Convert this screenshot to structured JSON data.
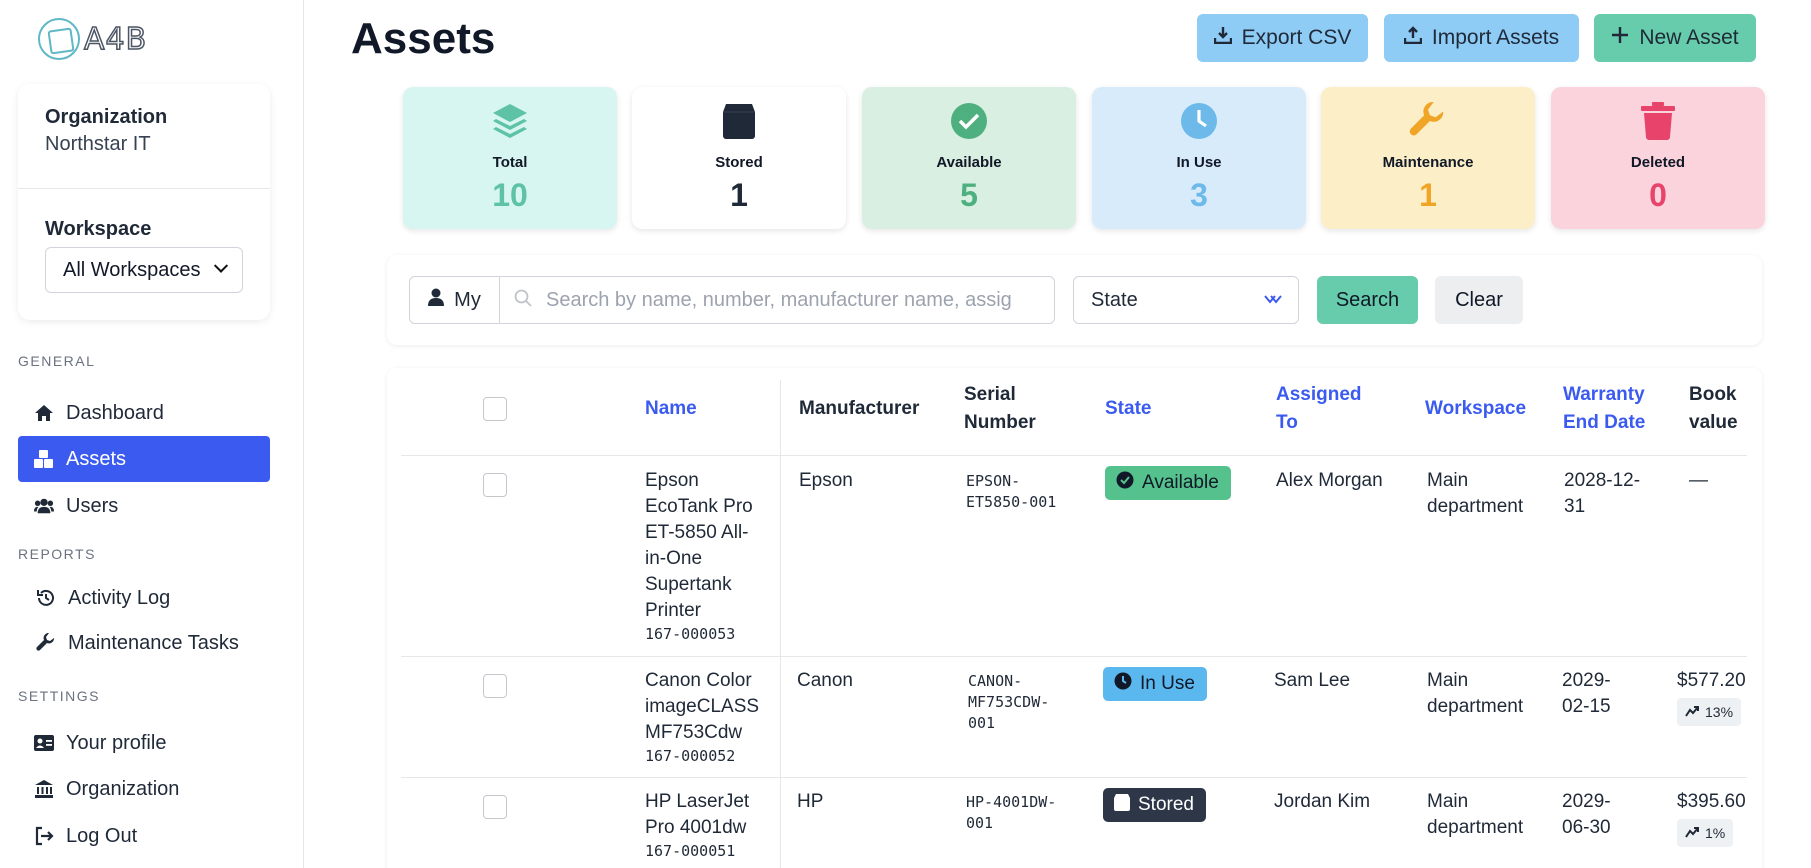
{
  "brand": {
    "logo_text": "A4B"
  },
  "org": {
    "label": "Organization",
    "name": "Northstar IT",
    "workspace_label": "Workspace",
    "workspace_value": "All Workspaces"
  },
  "nav": {
    "general_header": "GENERAL",
    "dashboard": "Dashboard",
    "assets": "Assets",
    "users": "Users",
    "reports_header": "REPORTS",
    "activity_log": "Activity Log",
    "maintenance_tasks": "Maintenance Tasks",
    "settings_header": "SETTINGS",
    "profile": "Your profile",
    "organization": "Organization",
    "logout": "Log Out"
  },
  "header": {
    "title": "Assets",
    "export": "Export CSV",
    "import": "Import Assets",
    "new": "New Asset"
  },
  "stats": [
    {
      "label": "Total",
      "value": "10",
      "color": "#5ec2a7",
      "bg": "#d7f6f1"
    },
    {
      "label": "Stored",
      "value": "1",
      "color": "#1f2937",
      "bg": "#ffffff"
    },
    {
      "label": "Available",
      "value": "5",
      "color": "#4fb07f",
      "bg": "#d9efe2"
    },
    {
      "label": "In Use",
      "value": "3",
      "color": "#6cb9ea",
      "bg": "#d8ebfb"
    },
    {
      "label": "Maintenance",
      "value": "1",
      "color": "#f0a526",
      "bg": "#fcefc7"
    },
    {
      "label": "Deleted",
      "value": "0",
      "color": "#e7436b",
      "bg": "#fbd3dd"
    }
  ],
  "filters": {
    "my": "My",
    "search_placeholder": "Search by name, number, manufacturer name, assig",
    "state": "State",
    "search_btn": "Search",
    "clear_btn": "Clear"
  },
  "table": {
    "headers": {
      "name": "Name",
      "manufacturer": "Manufacturer",
      "serial": "Serial Number",
      "state": "State",
      "assigned": "Assigned To",
      "workspace": "Workspace",
      "warranty": "Warranty End Date",
      "book": "Book value"
    },
    "rows": [
      {
        "name": "Epson EcoTank Pro ET-5850 All-in-One Supertank Printer",
        "number": "167-000053",
        "manufacturer": "Epson",
        "serial": "EPSON-ET5850-001",
        "state": "Available",
        "assigned": "Alex Morgan",
        "workspace": "Main department",
        "warranty": "2028-12-31",
        "book": "—",
        "pct": ""
      },
      {
        "name": "Canon Color imageCLASS MF753Cdw",
        "number": "167-000052",
        "manufacturer": "Canon",
        "serial": "CANON-MF753CDW-001",
        "state": "In Use",
        "assigned": "Sam Lee",
        "workspace": "Main department",
        "warranty": "2029-02-15",
        "book": "$577.20",
        "pct": "13%"
      },
      {
        "name": "HP LaserJet Pro 4001dw",
        "number": "167-000051",
        "manufacturer": "HP",
        "serial": "HP-4001DW-001",
        "state": "Stored",
        "assigned": "Jordan Kim",
        "workspace": "Main department",
        "warranty": "2029-06-30",
        "book": "$395.60",
        "pct": "1%"
      }
    ]
  }
}
